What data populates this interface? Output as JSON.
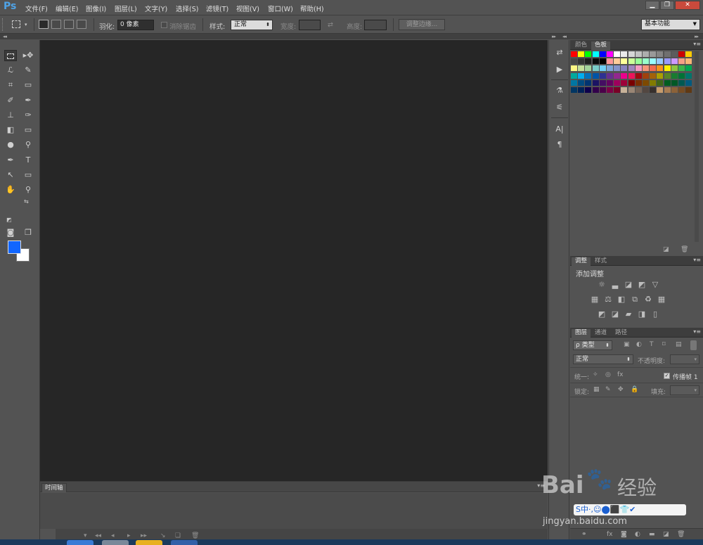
{
  "app": {
    "logo": "Ps"
  },
  "menu": [
    "文件(F)",
    "编辑(E)",
    "图像(I)",
    "图层(L)",
    "文字(Y)",
    "选择(S)",
    "滤镜(T)",
    "视图(V)",
    "窗口(W)",
    "帮助(H)"
  ],
  "options": {
    "feather_label": "羽化:",
    "feather_value": "0 像素",
    "antialias_label": "消除锯齿",
    "style_label": "样式:",
    "style_value": "正常",
    "width_label": "宽度:",
    "height_label": "高度:",
    "refine_edge": "调整边缘...",
    "workspace": "基本功能"
  },
  "colors": {
    "foreground": "#1166ff",
    "background": "#ffffff",
    "canvas": "#262626",
    "ui": "#535353"
  },
  "timeline": {
    "tab": "时间轴"
  },
  "swatch_panel": {
    "tabs": [
      "颜色",
      "色板"
    ],
    "active": 1,
    "swatches": [
      [
        "#ff0000",
        "#ffff00",
        "#00ff00",
        "#00ffff",
        "#0000ff",
        "#ff00ff",
        "#ffffff",
        "#ebebeb",
        "#d6d6d6",
        "#c2c2c2",
        "#adadad",
        "#999999",
        "#858585",
        "#707070",
        "#5c5c5c",
        "#cc0000",
        "#ffcc00"
      ],
      [
        "#474747",
        "#333333",
        "#1f1f1f",
        "#0a0a0a",
        "#000000",
        "#ff9999",
        "#ffcc99",
        "#ffff99",
        "#ccff99",
        "#99ff99",
        "#99ffcc",
        "#99ffff",
        "#99ccff",
        "#9999ff",
        "#cc99ff",
        "#f59f86",
        "#f7b677"
      ],
      [
        "#fcf685",
        "#c4df9b",
        "#a3d39c",
        "#7accc8",
        "#6ecff6",
        "#7ea7d8",
        "#8493ca",
        "#8882be",
        "#a186be",
        "#f49ac2",
        "#f69679",
        "#f26c4f",
        "#f7941d",
        "#fff200",
        "#8dc63f",
        "#39b54a",
        "#00a651"
      ],
      [
        "#00a99d",
        "#00aeef",
        "#0072bc",
        "#0054a6",
        "#2e3192",
        "#662d91",
        "#92278f",
        "#ec008c",
        "#ed145b",
        "#9e0b0f",
        "#a0410d",
        "#a36209",
        "#aba000",
        "#598527",
        "#197b30",
        "#007236",
        "#00746b"
      ],
      [
        "#0076a3",
        "#004b80",
        "#003471",
        "#1b1464",
        "#440e62",
        "#630460",
        "#9e005d",
        "#9e0039",
        "#790000",
        "#7b2e00",
        "#7d4900",
        "#827b00",
        "#406618",
        "#005e20",
        "#005826",
        "#005952",
        "#005b7f"
      ],
      [
        "#003663",
        "#002157",
        "#0d004c",
        "#32004b",
        "#4b0049",
        "#7b0046",
        "#7a0026",
        "#c7b299",
        "#998675",
        "#736357",
        "#534741",
        "#37302d",
        "#c69c6d",
        "#a67c52",
        "#8c6239",
        "#754c24",
        "#603913"
      ]
    ]
  },
  "adjust_panel": {
    "tabs": [
      "调整",
      "样式"
    ],
    "active": 0,
    "title": "添加调整",
    "rows": [
      [
        "☼",
        "▃",
        "◪",
        "◩",
        "▽"
      ],
      [
        "▦",
        "⚖",
        "◧",
        "⧉",
        "♻",
        "▦"
      ],
      [
        "◩",
        "◪",
        "▰",
        "◨",
        "▯"
      ]
    ]
  },
  "layers_panel": {
    "tabs": [
      "图层",
      "通道",
      "路径"
    ],
    "active": 0,
    "filter_label": "ρ 类型",
    "blend": "正常",
    "opacity_label": "不透明度:",
    "unify_label": "统一:",
    "propagate_label": "传播帧 1",
    "lock_label": "锁定:",
    "fill_label": "填充:"
  },
  "watermark": {
    "brand_a": "Bai",
    "brand_b": "经验",
    "url": "jingyan.baidu.com",
    "ime": "S中·,☺⬤⬛👕✔"
  }
}
